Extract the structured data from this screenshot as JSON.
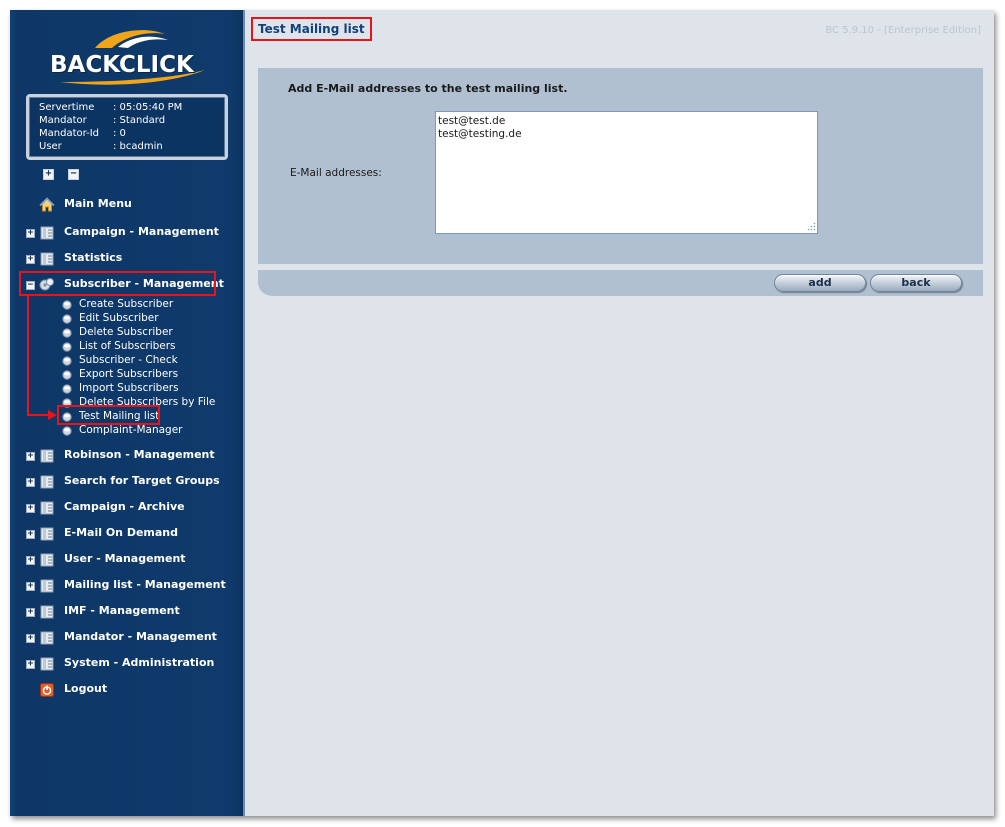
{
  "app": {
    "logo_text": "BACKCLICK",
    "version": "BC 5.9.10 - [Enterprise Edition]"
  },
  "info": {
    "rows": [
      {
        "key": "Servertime",
        "value": ": 05:05:40 PM"
      },
      {
        "key": "Mandator",
        "value": ": Standard"
      },
      {
        "key": "Mandator-Id",
        "value": ": 0"
      },
      {
        "key": "User",
        "value": ": bcadmin"
      }
    ]
  },
  "expand_all_symbol": "+",
  "collapse_all_symbol": "−",
  "sidebar": {
    "main_menu": "Main Menu",
    "items": [
      {
        "label": "Campaign - Management",
        "state": "+"
      },
      {
        "label": "Statistics",
        "state": "+"
      },
      {
        "label": "Subscriber - Management",
        "state": "−"
      },
      {
        "label": "Robinson - Management",
        "state": "+"
      },
      {
        "label": "Search for Target Groups",
        "state": "+"
      },
      {
        "label": "Campaign - Archive",
        "state": "+"
      },
      {
        "label": "E-Mail On Demand",
        "state": "+"
      },
      {
        "label": "User - Management",
        "state": "+"
      },
      {
        "label": "Mailing list - Management",
        "state": "+"
      },
      {
        "label": "IMF - Management",
        "state": "+"
      },
      {
        "label": "Mandator - Management",
        "state": "+"
      },
      {
        "label": "System - Administration",
        "state": "+"
      }
    ],
    "subitems": [
      "Create Subscriber",
      "Edit Subscriber",
      "Delete Subscriber",
      "List of Subscribers",
      "Subscriber - Check",
      "Export Subscribers",
      "Import Subscribers",
      "Delete Subscribers by File",
      "Test Mailing list",
      "Complaint-Manager"
    ],
    "logout": "Logout"
  },
  "main": {
    "title": "Test Mailing list",
    "heading": "Add E-Mail addresses to the test mailing list.",
    "email_label": "E-Mail addresses:",
    "email_value": "test@test.de\ntest@testing.de",
    "add_label": "add",
    "back_label": "back"
  },
  "colors": {
    "sidebar": "#0f3a6b",
    "highlight": "#e8141b",
    "panel": "#b1c0d1",
    "title": "#12427a"
  }
}
